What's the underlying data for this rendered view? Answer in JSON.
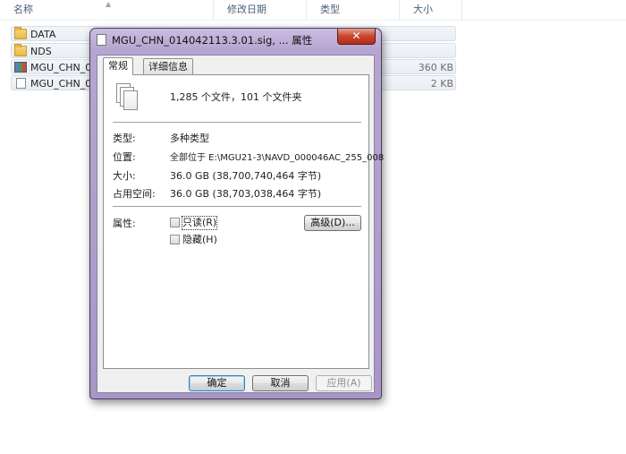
{
  "explorer": {
    "columns": [
      "名称",
      "修改日期",
      "类型",
      "大小"
    ],
    "files": [
      {
        "name": "DATA",
        "icon": "folder-icon",
        "size": ""
      },
      {
        "name": "NDS",
        "icon": "folder-icon",
        "size": ""
      },
      {
        "name": "MGU_CHN_0",
        "icon": "archive-icon",
        "size": "360 KB"
      },
      {
        "name": "MGU_CHN_0",
        "icon": "document-icon",
        "size": "2 KB"
      }
    ]
  },
  "dialog": {
    "title": "MGU_CHN_014042113.3.01.sig, ... 属性",
    "close_label": "✕",
    "tabs": [
      "常规",
      "详细信息"
    ],
    "summary": "1,285 个文件，101 个文件夹",
    "properties": [
      {
        "label": "类型:",
        "value": "多种类型"
      },
      {
        "label": "位置:",
        "value": "全部位于 E:\\MGU21-3\\NAVD_000046AC_255_008"
      },
      {
        "label": "大小:",
        "value": "36.0 GB (38,700,740,464 字节)"
      },
      {
        "label": "占用空间:",
        "value": "36.0 GB (38,703,038,464 字节)"
      }
    ],
    "attributes_label": "属性:",
    "readonly_label": "只读(R)",
    "hidden_label": "隐藏(H)",
    "advanced_label": "高级(D)...",
    "buttons": {
      "ok": "确定",
      "cancel": "取消",
      "apply": "应用(A)"
    }
  }
}
